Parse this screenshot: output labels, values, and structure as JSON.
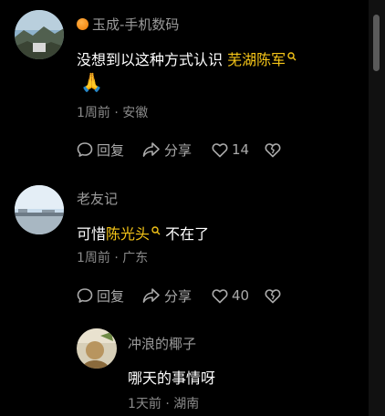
{
  "comments": [
    {
      "username": "玉成-手机数码",
      "text_prefix": "没想到以这种方式认识",
      "mention": "芜湖陈军",
      "emoji": "🙏",
      "meta": "1周前 · 安徽",
      "reply_label": "回复",
      "share_label": "分享",
      "like_count": "14"
    },
    {
      "username": "老友记",
      "text_prefix": "可惜",
      "mention": "陈光头",
      "text_suffix": "不在了",
      "meta": "1周前 · 广东",
      "reply_label": "回复",
      "share_label": "分享",
      "like_count": "40"
    },
    {
      "username": "冲浪的椰子",
      "text": "哪天的事情呀",
      "meta": "1天前 · 湖南"
    }
  ],
  "colors": {
    "background": "#000000",
    "mention": "#f5c518",
    "secondary_text": "#8a8a8a"
  },
  "icons": [
    "search-icon",
    "reply-icon",
    "share-icon",
    "like-heart-icon",
    "dislike-broken-heart-icon"
  ]
}
